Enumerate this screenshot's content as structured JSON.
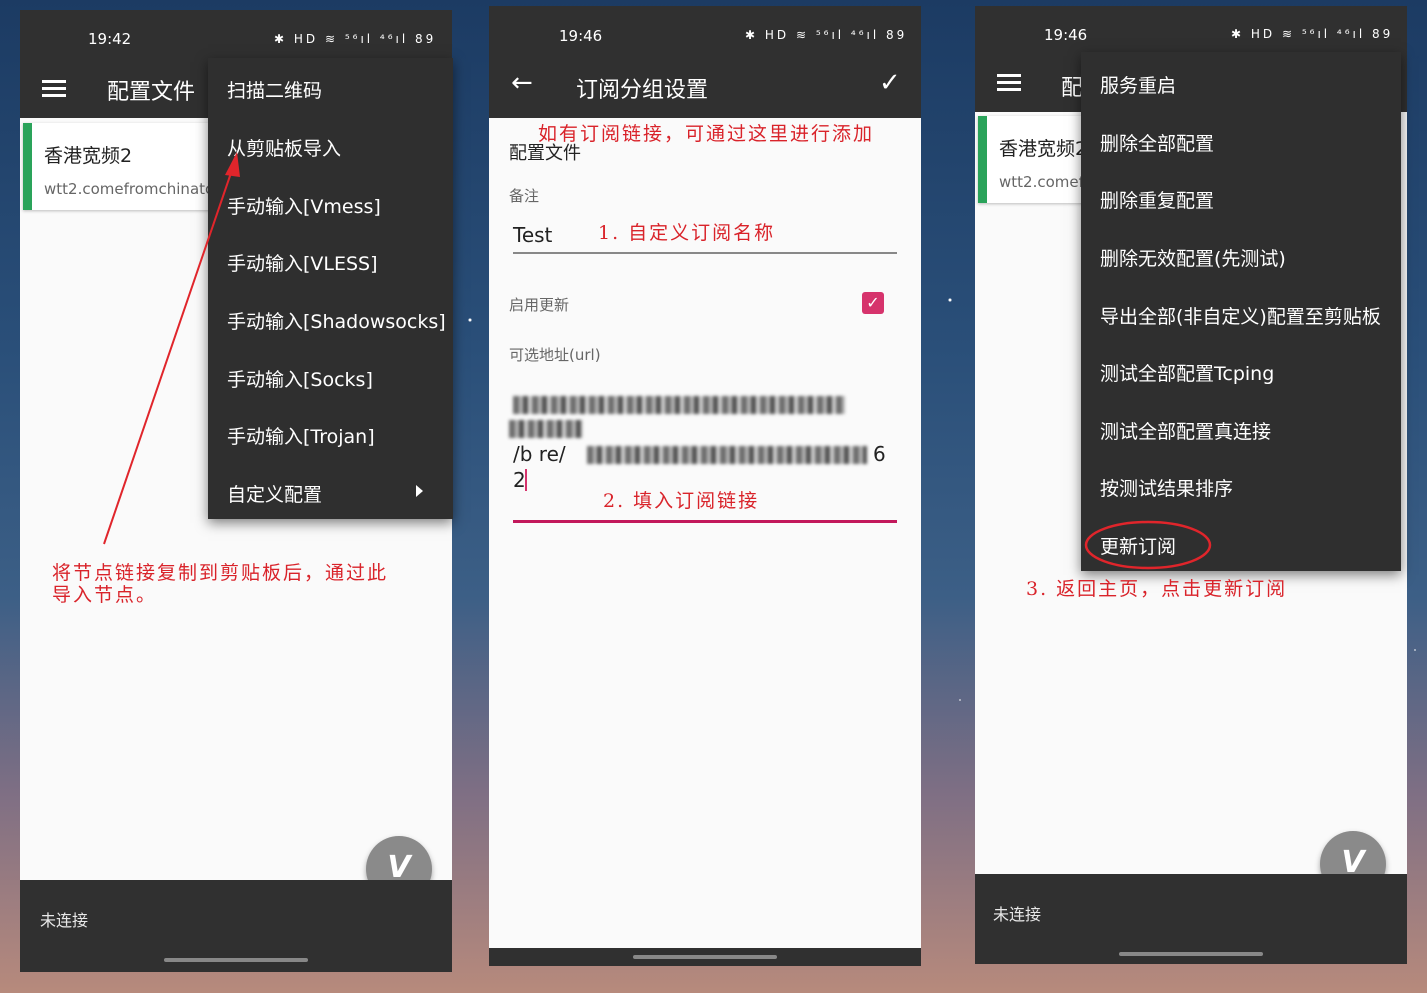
{
  "panel1": {
    "time": "19:42",
    "status_icons": "✱ HD ≋ ⁵⁶ıl ⁴⁶ıl 89",
    "title": "配置文件",
    "server_name": "香港宽频2",
    "server_address": "wtt2.comefromchinatc",
    "menu_items": [
      "扫描二维码",
      "从剪贴板导入",
      "手动输入[Vmess]",
      "手动输入[VLESS]",
      "手动输入[Shadowsocks]",
      "手动输入[Socks]",
      "手动输入[Trojan]",
      "自定义配置"
    ],
    "status": "未连接",
    "fab": "V",
    "annotation": [
      "将节点链接复制到剪贴板后，通过此",
      "导入节点。"
    ]
  },
  "panel2": {
    "time": "19:46",
    "status_icons": "✱ HD ≋ ⁵⁶ıl ⁴⁶ıl 89",
    "title": "订阅分组设置",
    "back_icon": "←",
    "confirm_icon": "✓",
    "section_label": "配置文件",
    "annotation_top": "如有订阅链接，可通过这里进行添加",
    "remarks_label": "备注",
    "remarks_value": "Test",
    "annotation_step1": "1. 自定义订阅名称",
    "enable_update_label": "启用更新",
    "url_label": "可选地址(url)",
    "url_visible_tail1": "/b re/",
    "url_visible_tail2": "6",
    "url_visible_line3": "2",
    "annotation_step2": "2. 填入订阅链接"
  },
  "panel3": {
    "time": "19:46",
    "status_icons": "✱ HD ≋ ⁵⁶ıl ⁴⁶ıl 89",
    "title_partial": "配",
    "server_name": "香港宽频2",
    "server_address": "wtt2.comef",
    "menu_items": [
      "服务重启",
      "删除全部配置",
      "删除重复配置",
      "删除无效配置(先测试)",
      "导出全部(非自定义)配置至剪贴板",
      "测试全部配置Tcping",
      "测试全部配置真连接",
      "按测试结果排序",
      "更新订阅"
    ],
    "status": "未连接",
    "fab": "V",
    "annotation": "3. 返回主页，点击更新订阅"
  },
  "colors": {
    "dark_bar": "#303030",
    "accent_pink": "#d6336c",
    "annotation_red": "#d9232a",
    "card_green": "#2aa35a"
  }
}
